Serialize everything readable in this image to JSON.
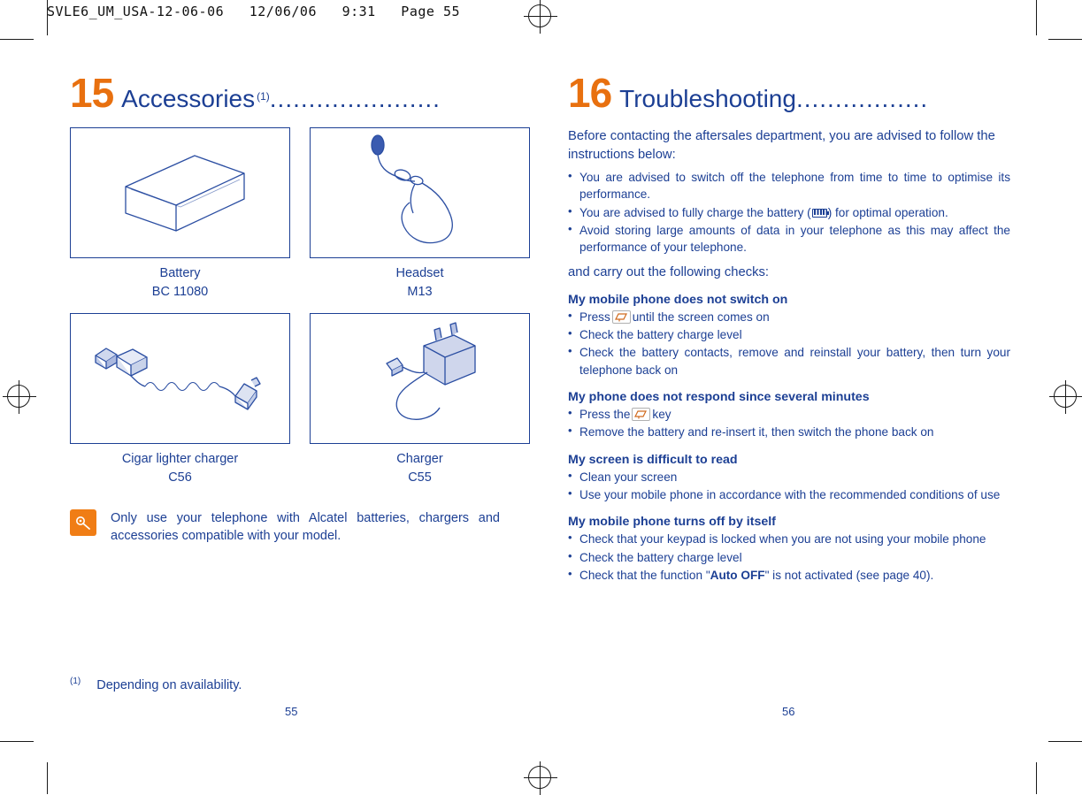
{
  "slug": "SVLE6_UM_USA-12-06-06   12/06/06   9:31   Page 55",
  "left_page": {
    "chapter_number": "15",
    "chapter_title": "Accessories",
    "chapter_sup": "(1)",
    "chapter_dots": "......................",
    "accessories": [
      {
        "name": "Battery",
        "model": "BC 11080",
        "icon": "battery-illustration"
      },
      {
        "name": "Headset",
        "model": "M13",
        "icon": "headset-illustration"
      },
      {
        "name": "Cigar lighter charger",
        "model": "C56",
        "icon": "cigar-lighter-charger-illustration"
      },
      {
        "name": "Charger",
        "model": "C55",
        "icon": "charger-illustration"
      }
    ],
    "note": {
      "icon": "info-note-icon",
      "text": "Only use your telephone with Alcatel batteries, chargers and accessories compatible with your model."
    },
    "footnote": {
      "marker": "(1)",
      "text": "Depending on availability."
    },
    "page_number": "55"
  },
  "right_page": {
    "chapter_number": "16",
    "chapter_title": "Troubleshooting",
    "chapter_dots": ".................",
    "intro": "Before contacting the aftersales department, you are advised to follow the instructions below:",
    "intro_bullets": [
      {
        "before": "You are advised to switch off the telephone from time to time to optimise its performance.",
        "icon": null,
        "after": ""
      },
      {
        "before": "You are advised to fully charge the battery (",
        "icon": "battery-icon",
        "after": ") for optimal operation."
      },
      {
        "before": "Avoid storing large amounts of data in your telephone as this may affect the performance of your telephone.",
        "icon": null,
        "after": ""
      }
    ],
    "mid_line": "and carry out the following checks:",
    "sections": [
      {
        "heading": "My mobile phone does not switch on",
        "items": [
          {
            "before": "Press",
            "icon": "power-key-icon",
            "after": "until the screen comes on"
          },
          {
            "before": "Check the battery charge level",
            "icon": null,
            "after": ""
          },
          {
            "before": "Check the battery contacts, remove and reinstall your battery, then turn your telephone back on",
            "icon": null,
            "after": ""
          }
        ]
      },
      {
        "heading": "My phone does not respond since several minutes",
        "items": [
          {
            "before": "Press the",
            "icon": "power-key-icon",
            "after": "key"
          },
          {
            "before": "Remove the battery and re-insert it, then switch the phone back on",
            "icon": null,
            "after": ""
          }
        ]
      },
      {
        "heading": "My screen is difficult to read",
        "items": [
          {
            "before": "Clean your screen",
            "icon": null,
            "after": ""
          },
          {
            "before": "Use your mobile phone in accordance with the recommended conditions of use",
            "icon": null,
            "after": ""
          }
        ]
      },
      {
        "heading": "My mobile phone turns off by itself",
        "items": [
          {
            "before": "Check that your keypad is locked when you are not using your mobile phone",
            "icon": null,
            "after": ""
          },
          {
            "before": "Check the battery charge level",
            "icon": null,
            "after": ""
          },
          {
            "before": "Check that the function \"",
            "bold": "Auto OFF",
            "after": "\" is not activated (see page 40)."
          }
        ]
      }
    ],
    "page_number": "56"
  },
  "colors": {
    "brand_blue": "#1c3f94",
    "accent_orange": "#e8700f",
    "note_box": "#f07d15"
  }
}
